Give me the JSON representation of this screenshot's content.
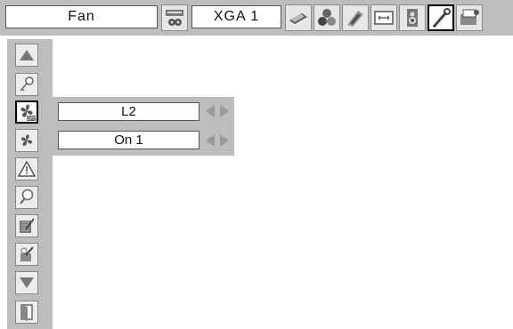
{
  "header": {
    "menu_title": "Fan",
    "input_signal": "XGA 1",
    "icons": [
      "pc-adjust-icon",
      "image-select-icon",
      "image-adjust-icon",
      "screen-icon",
      "sound-icon",
      "setting-icon",
      "information-icon"
    ]
  },
  "sidebar": {
    "items": [
      "scroll-up-icon",
      "key-icon",
      "fan-off-icon",
      "fan-icon",
      "warning-icon",
      "lamp-icon",
      "filter-icon",
      "filter-counter-icon",
      "scroll-down-icon",
      "exit-icon"
    ]
  },
  "panel": {
    "row1_value": "L2",
    "row2_value": "On 1"
  },
  "colors": {
    "bar": "#bdbdbd",
    "selected_border": "#000000",
    "arrow": "#9a9a9a"
  }
}
